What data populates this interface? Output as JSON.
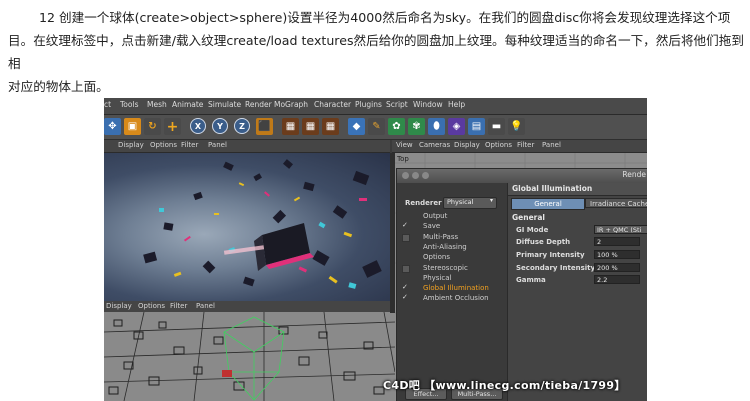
{
  "article": {
    "line1": "12 创建一个球体(create>object>sphere)设置半径为4000然后命名为sky。在我们的圆盘disc你将会发现纹理选择这个项",
    "line2": "目。在纹理标签中，点击新建/载入纹理create/load textures然后给你的圆盘加上纹理。每种纹理适当的命名一下，然后将他们拖到相",
    "line3": "对应的物体上面。"
  },
  "menu": [
    "ct",
    "Tools",
    "Mesh",
    "Animate",
    "Simulate",
    "Render",
    "MoGraph",
    "Character",
    "Plugins",
    "Script",
    "Window",
    "Help"
  ],
  "toolbar": {
    "axis_x": "X",
    "axis_y": "Y",
    "axis_z": "Z"
  },
  "top_viewport_bar": [
    "Display",
    "Options",
    "Filter",
    "Panel"
  ],
  "right_viewport_bar": [
    "View",
    "Cameras",
    "Display",
    "Options",
    "Filter",
    "Panel"
  ],
  "right_viewport_label": "Top",
  "bottom_viewport_bar": [
    "Display",
    "Options",
    "Filter",
    "Panel"
  ],
  "dialog": {
    "title": "Rende",
    "renderer_label": "Renderer",
    "renderer_value": "Physical",
    "settings": [
      {
        "label": "Output",
        "state": "none"
      },
      {
        "label": "Save",
        "state": "check"
      },
      {
        "label": "Multi-Pass",
        "state": "box"
      },
      {
        "label": "Anti-Aliasing",
        "state": "none"
      },
      {
        "label": "Options",
        "state": "none"
      },
      {
        "label": "Stereoscopic",
        "state": "box"
      },
      {
        "label": "Physical",
        "state": "none"
      },
      {
        "label": "Global Illumination",
        "state": "check",
        "active": true
      },
      {
        "label": "Ambient Occlusion",
        "state": "check"
      }
    ],
    "panel_title": "Global Illumination",
    "tab_general": "General",
    "tab_irradiance": "Irradiance Cache",
    "section": "General",
    "gi_mode_label": "GI Mode",
    "gi_mode_value": "IR + QMC (Sti",
    "params": [
      {
        "label": "Diffuse Depth",
        "value": "2"
      },
      {
        "label": "Primary Intensity",
        "value": "100 %"
      },
      {
        "label": "Secondary Intensity",
        "value": "200 %"
      },
      {
        "label": "Gamma",
        "value": "2.2"
      }
    ],
    "effect_button": "Effect...",
    "multipass_button": "Multi-Pass..."
  },
  "watermark": "C4D吧 【www.linecg.com/tieba/1799】",
  "colors": {
    "accent": "#f0a020",
    "tab_active": "#6e8fb5"
  }
}
